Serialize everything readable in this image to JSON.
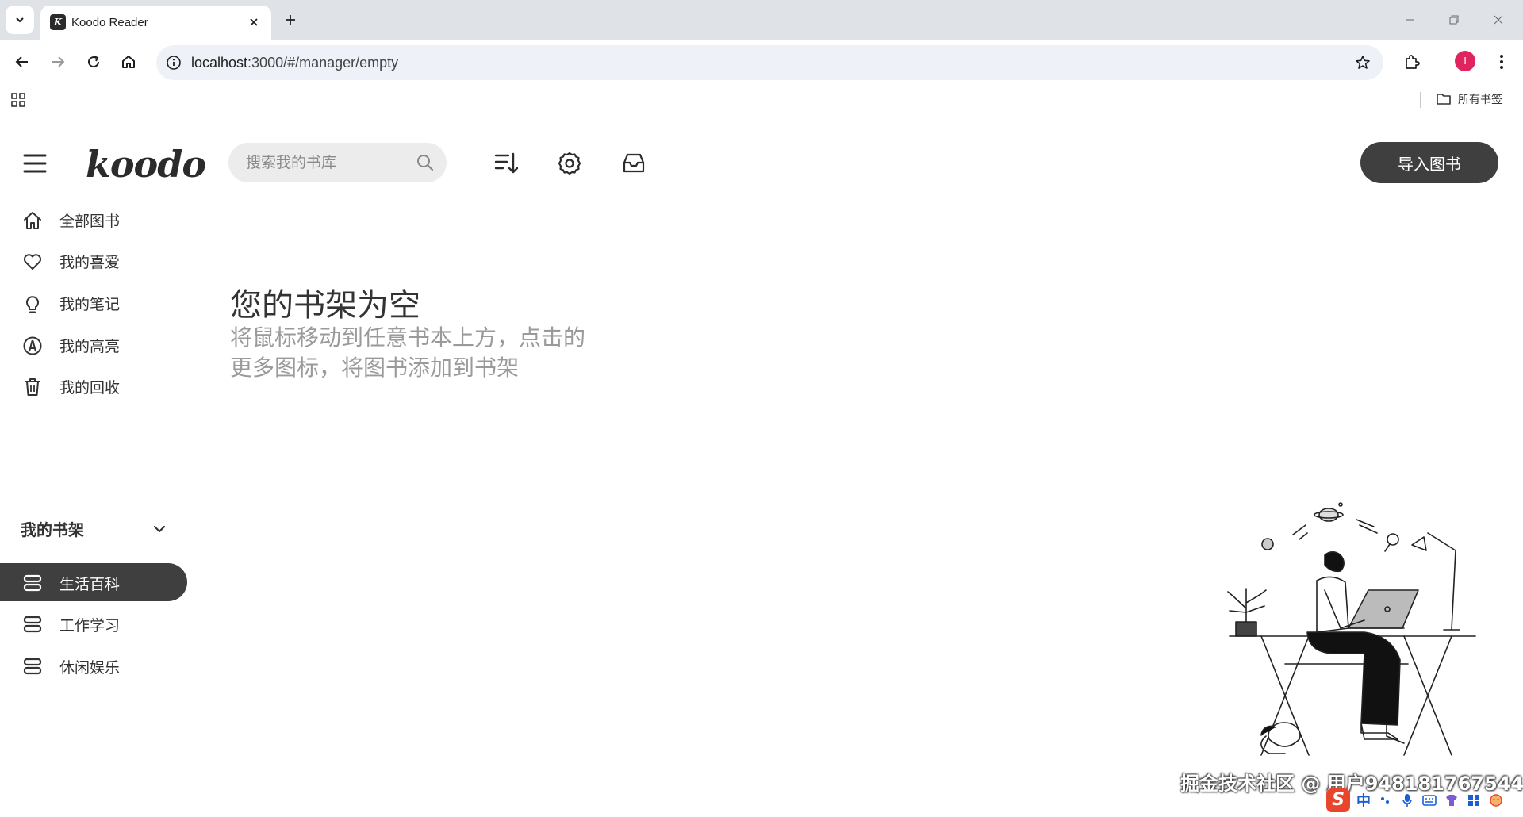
{
  "browser": {
    "tab_title": "Koodo Reader",
    "url_host": "localhost",
    "url_path": ":3000/#/manager/empty",
    "bookmarks_folder_label": "所有书签",
    "profile_initial": "I",
    "profile_color": "#e0245e"
  },
  "app": {
    "logo": "koodo",
    "search_placeholder": "搜索我的书库",
    "import_button": "导入图书",
    "accent": "#3f3f3f",
    "nav": [
      {
        "label": "全部图书",
        "icon": "home-icon"
      },
      {
        "label": "我的喜爱",
        "icon": "heart-icon"
      },
      {
        "label": "我的笔记",
        "icon": "lightbulb-icon"
      },
      {
        "label": "我的高亮",
        "icon": "highlight-icon"
      },
      {
        "label": "我的回收",
        "icon": "trash-icon"
      }
    ],
    "shelf_title": "我的书架",
    "shelves": [
      {
        "label": "生活百科",
        "active": true
      },
      {
        "label": "工作学习",
        "active": false
      },
      {
        "label": "休闲娱乐",
        "active": false
      }
    ],
    "empty_title": "您的书架为空",
    "empty_description_line1": "将鼠标移动到任意书本上方，点击的",
    "empty_description_line2": "更多图标，将图书添加到书架"
  },
  "overlay": {
    "watermark": "掘金技术社区 @ 用户948181767544",
    "ime_logo": "S",
    "ime_mode": "中"
  }
}
